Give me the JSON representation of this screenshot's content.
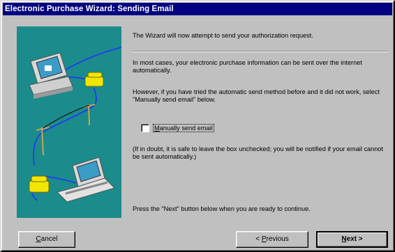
{
  "window": {
    "title": "Electronic Purchase Wizard: Sending Email"
  },
  "content": {
    "intro": "The Wizard will now attempt to send your authorization request.",
    "p1": "In most cases, your electronic purchase information can be sent over the internet automatically.",
    "p2": "However, if you have tried the automatic send method before and it did not work, select \"Manually send email\" below.",
    "checkbox": {
      "label_u": "M",
      "label_rest": "anually send email",
      "checked": false
    },
    "p3": "(If in doubt, it is safe to leave the box unchecked; you will be notified if your email cannot be sent automatically.)",
    "footer": "Press the \"Next\" button below when you are ready to continue."
  },
  "buttons": {
    "cancel_u": "C",
    "cancel_rest": "ancel",
    "previous_pre": "< ",
    "previous_u": "P",
    "previous_rest": "revious",
    "next_u": "N",
    "next_rest": "ext >"
  },
  "colors": {
    "titlebar": "#000080",
    "art_bg": "#1b8b8b",
    "face": "#c0c0c0"
  }
}
